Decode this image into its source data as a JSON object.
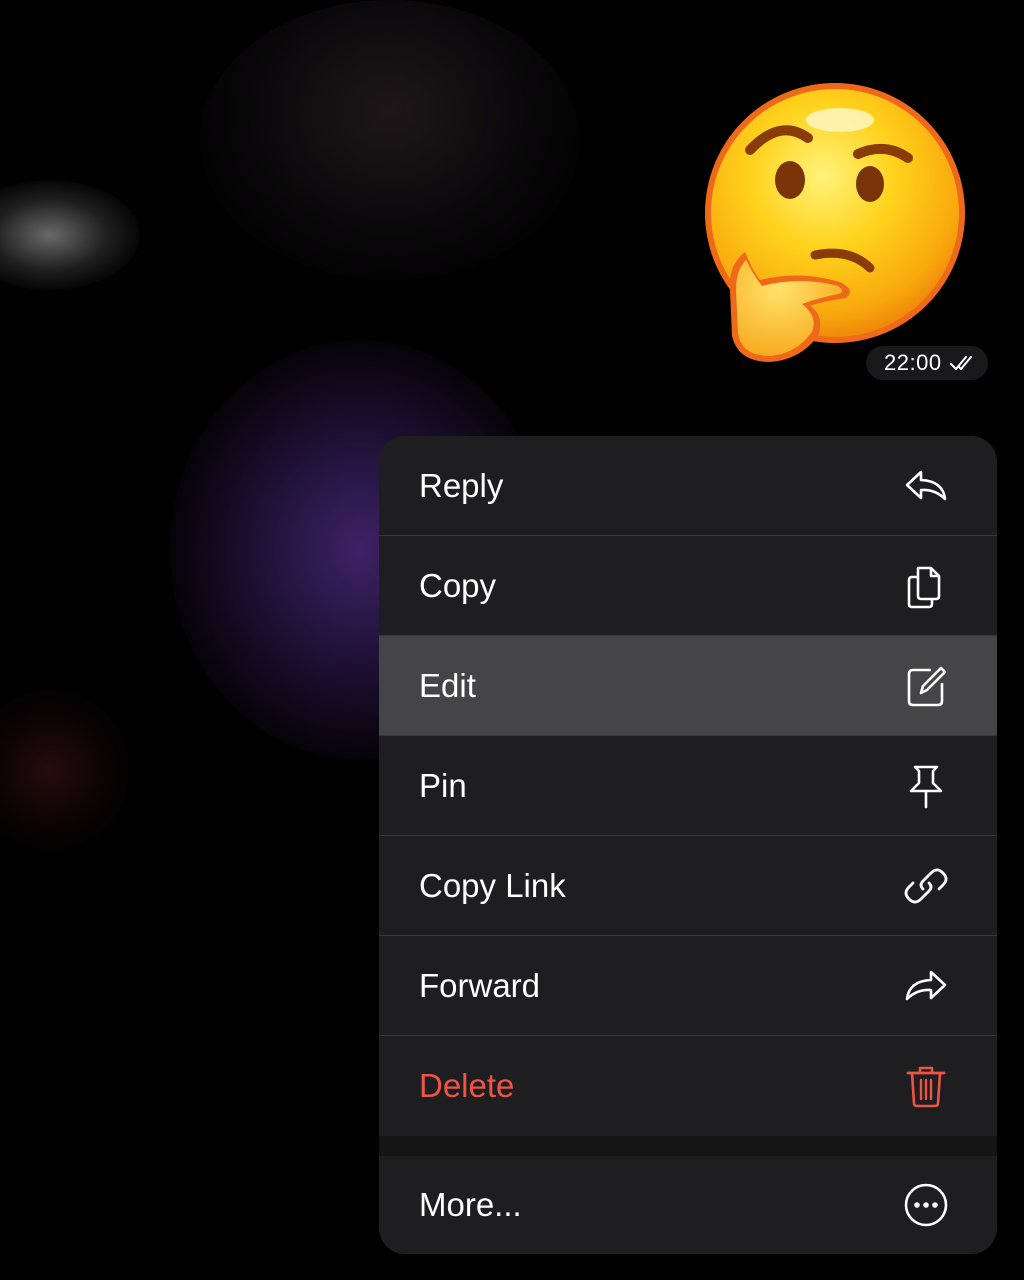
{
  "message": {
    "sticker_emoji": "🤔",
    "time": "22:00",
    "status_icon": "double-check-icon"
  },
  "menu": {
    "items": [
      {
        "label": "Reply",
        "icon": "reply-icon"
      },
      {
        "label": "Copy",
        "icon": "copy-icon"
      },
      {
        "label": "Edit",
        "icon": "edit-icon",
        "highlighted": true
      },
      {
        "label": "Pin",
        "icon": "pin-icon"
      },
      {
        "label": "Copy Link",
        "icon": "link-icon"
      },
      {
        "label": "Forward",
        "icon": "forward-icon"
      },
      {
        "label": "Delete",
        "icon": "trash-icon",
        "destructive": true
      }
    ],
    "more": {
      "label": "More...",
      "icon": "ellipsis-circle-icon"
    }
  },
  "colors": {
    "menu_background": "#1c1c1e",
    "highlight": "#454547",
    "destructive": "#ec5545",
    "text": "#ffffff"
  }
}
